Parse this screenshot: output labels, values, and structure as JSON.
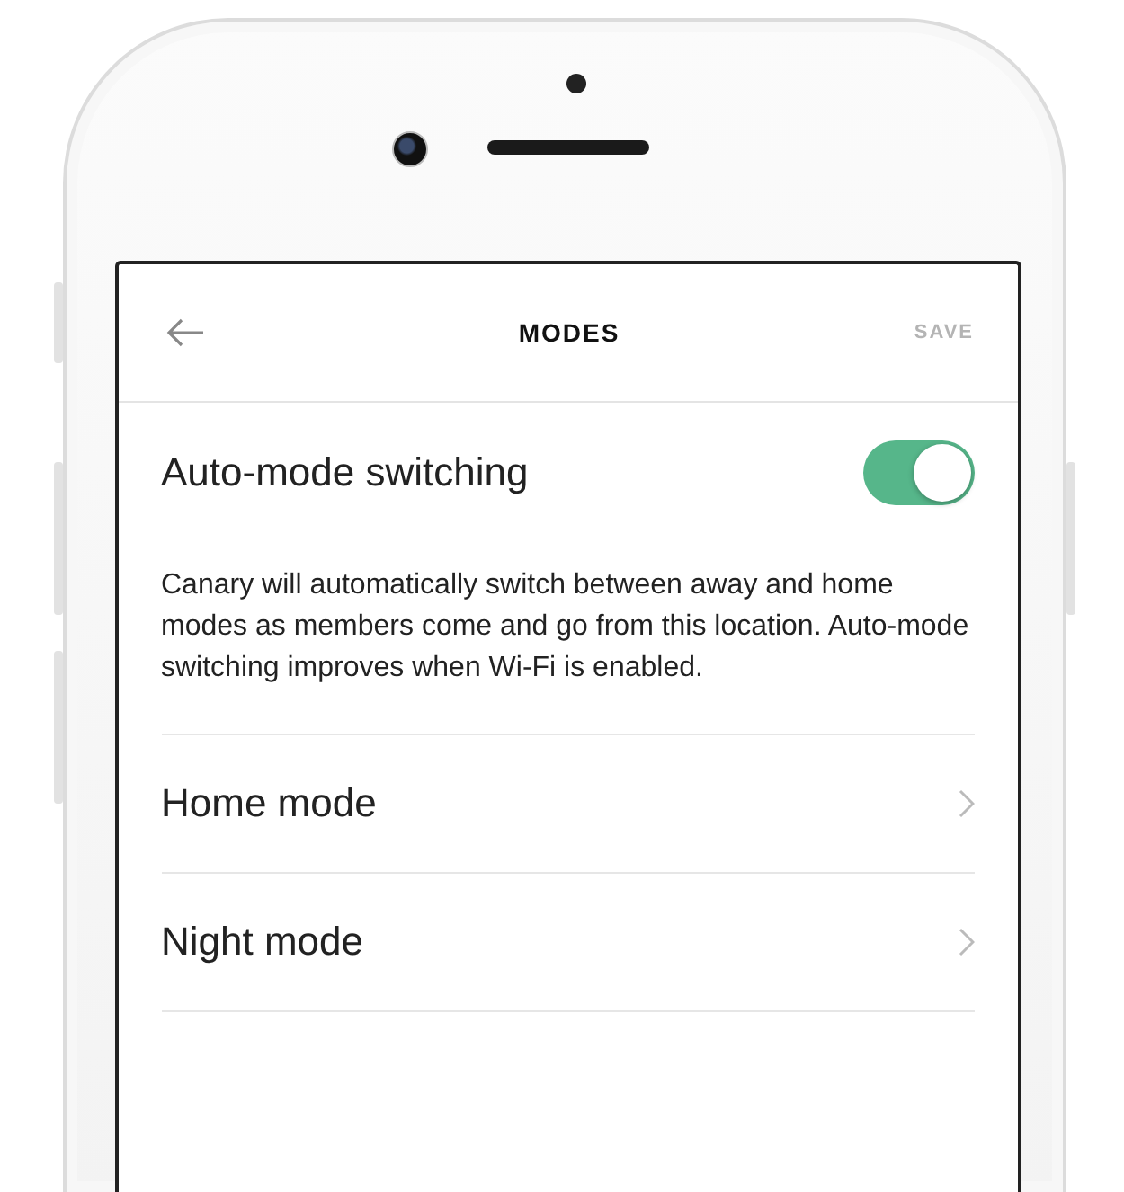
{
  "header": {
    "title": "MODES",
    "action": {
      "label": "SAVE",
      "disabled": true
    }
  },
  "auto_switch": {
    "label": "Auto-mode switching",
    "on": true
  },
  "description": "Canary will automatically switch between away and home modes as members come and go from this location. Auto-mode switching improves when Wi-Fi is enabled.",
  "modes": [
    {
      "label": "Home mode"
    },
    {
      "label": "Night mode"
    }
  ]
}
